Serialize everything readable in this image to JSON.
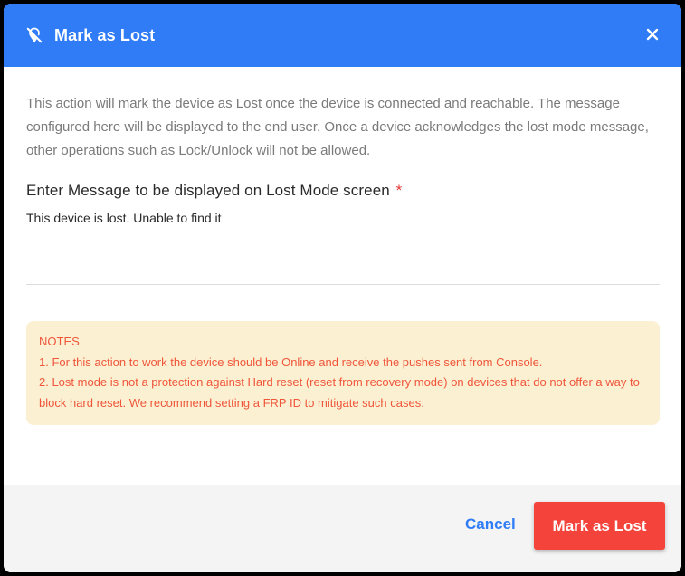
{
  "dialog": {
    "title": "Mark as Lost",
    "title_icon": "location-off-icon",
    "close_icon": "close-icon",
    "intro_text": "This action will mark the device as Lost once the device is connected and reachable. The message configured here will be displayed to the end user. Once a device acknowledges the lost mode message, other operations such as Lock/Unlock will not be allowed.",
    "message_field": {
      "label": "Enter Message to be displayed on Lost Mode screen",
      "required_marker": "*",
      "value": "This device is lost. Unable to find it"
    },
    "notes": {
      "heading": "NOTES",
      "items": [
        "1. For this action to work the device should be Online and receive the pushes sent from Console.",
        "2. Lost mode is not a protection against Hard reset (reset from recovery mode) on devices that do not offer a way to block hard reset. We recommend setting a FRP ID to mitigate such cases."
      ]
    },
    "footer": {
      "cancel_label": "Cancel",
      "submit_label": "Mark as Lost"
    }
  },
  "colors": {
    "header": "#2f7cf6",
    "primary_button": "#f4433a",
    "notes_bg": "#fbf0d2",
    "notes_text": "#f0553a",
    "link": "#2f7cf6",
    "required": "#e53935"
  }
}
